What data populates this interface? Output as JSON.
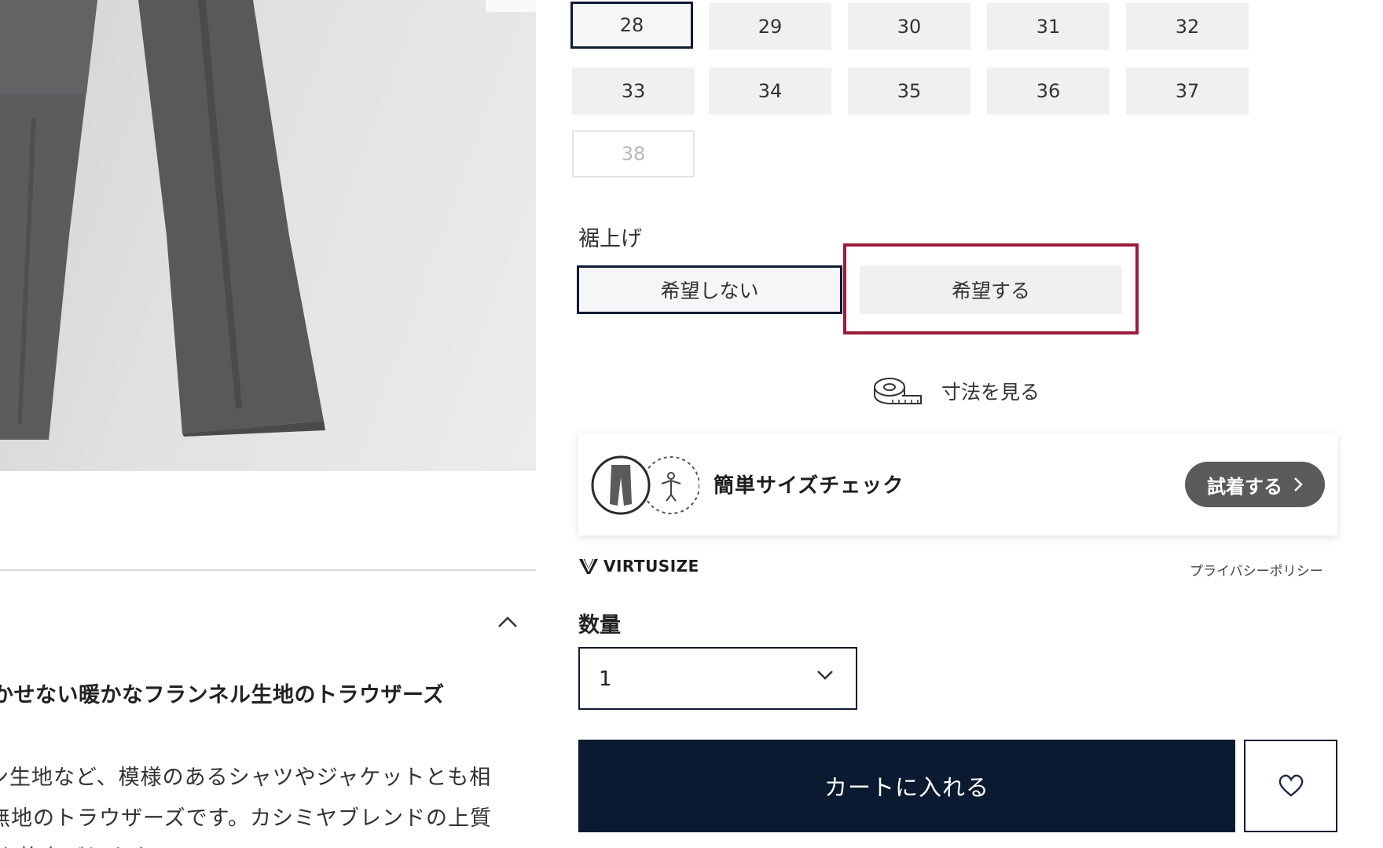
{
  "sizes": {
    "options": [
      "28",
      "29",
      "30",
      "31",
      "32",
      "33",
      "34",
      "35",
      "36",
      "37",
      "38"
    ],
    "selected": "28",
    "unavailable": [
      "38"
    ]
  },
  "hem": {
    "label": "裾上げ",
    "option_no": "希望しない",
    "option_yes": "希望する",
    "selected": "希望しない"
  },
  "measurements": {
    "link_label": "寸法を見る"
  },
  "virtusize": {
    "title": "簡単サイズチェック",
    "try_button": "試着する",
    "brand": "VIRTUSIZE",
    "privacy_link": "プライバシーポリシー"
  },
  "quantity": {
    "label": "数量",
    "value": "1"
  },
  "cart": {
    "add_label": "カートに入れる"
  },
  "description": {
    "heading": "かせない暖かなフランネル生地のトラウザーズ",
    "lines": [
      "ン生地など、模様のあるシャツやジャケットとも相",
      "無地のトラウザーズです。カシミヤブレンドの上質",
      "を格上げします。"
    ]
  },
  "colors": {
    "navy": "#0a1a30",
    "highlight": "#9c1c3a",
    "tile_bg": "#f0f0f0",
    "try_button_bg": "#5b5b5b"
  },
  "icons": {
    "collapse": "chevron-up-icon",
    "measure": "tape-measure-icon",
    "select": "chevron-down-icon",
    "favorite": "heart-icon"
  }
}
